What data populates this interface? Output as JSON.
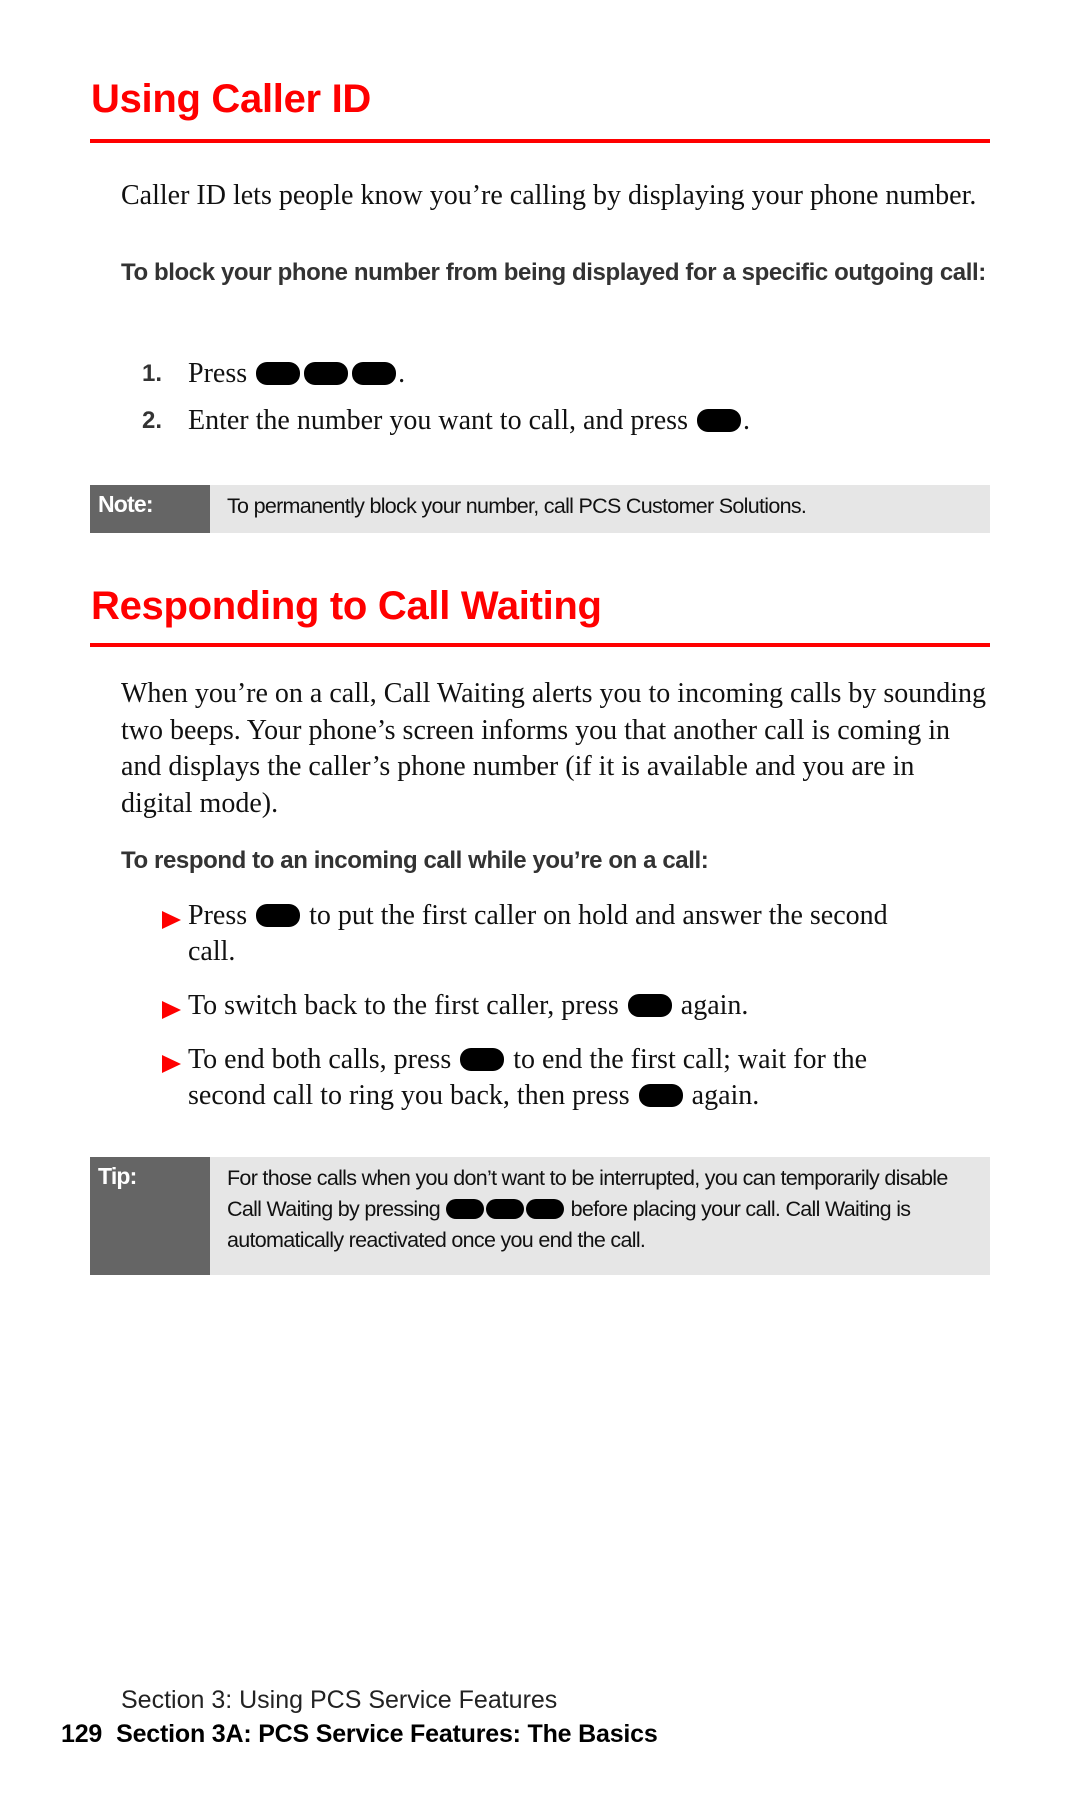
{
  "section1": {
    "title": "Using Caller ID",
    "intro": "Caller ID lets people know you’re calling by displaying your phone number.",
    "procedure_label": "To block your phone number from being displayed for a specific outgoing call:",
    "steps": [
      {
        "number": "1.",
        "before": "Press",
        "keys": 3,
        "after": "."
      },
      {
        "number": "2.",
        "before": "Enter the number you want to call, and press",
        "keys": 1,
        "after": "."
      }
    ],
    "note": {
      "label": "Note:",
      "text": "To permanently block your number, call PCS Customer Solutions."
    }
  },
  "section2": {
    "title": "Responding to Call Waiting",
    "intro": "When you’re on a call, Call Waiting alerts you to incoming calls by sounding two beeps. Your phone’s screen informs you that another call is coming in and displays the caller’s phone number (if it is available and you are in digital mode).",
    "procedure_label": "To respond to an incoming call while you’re on a call:",
    "bullets": [
      {
        "before": "Press",
        "after": "to put the first caller on hold and answer the second call."
      },
      {
        "before": "To switch back to the first caller, press",
        "after": "again."
      },
      {
        "before": "To end both calls, press",
        "middle": "to end the first call; wait for the second call to ring you back, then press",
        "after": "again."
      }
    ],
    "tip": {
      "label": "Tip:",
      "before": "For those calls when you don’t want to be interrupted, you can temporarily disable Call Waiting by pressing",
      "after": "before placing your call. Call Waiting is automatically reactivated once you end the call."
    }
  },
  "footer": {
    "section": "Section 3: Using PCS Service Features",
    "page_number": "129",
    "chapter": "Section 3A: PCS Service Features: The Basics"
  },
  "colors": {
    "accent": "#ff0000",
    "note_label_bg": "#656565",
    "note_bg": "#e6e6e6"
  }
}
